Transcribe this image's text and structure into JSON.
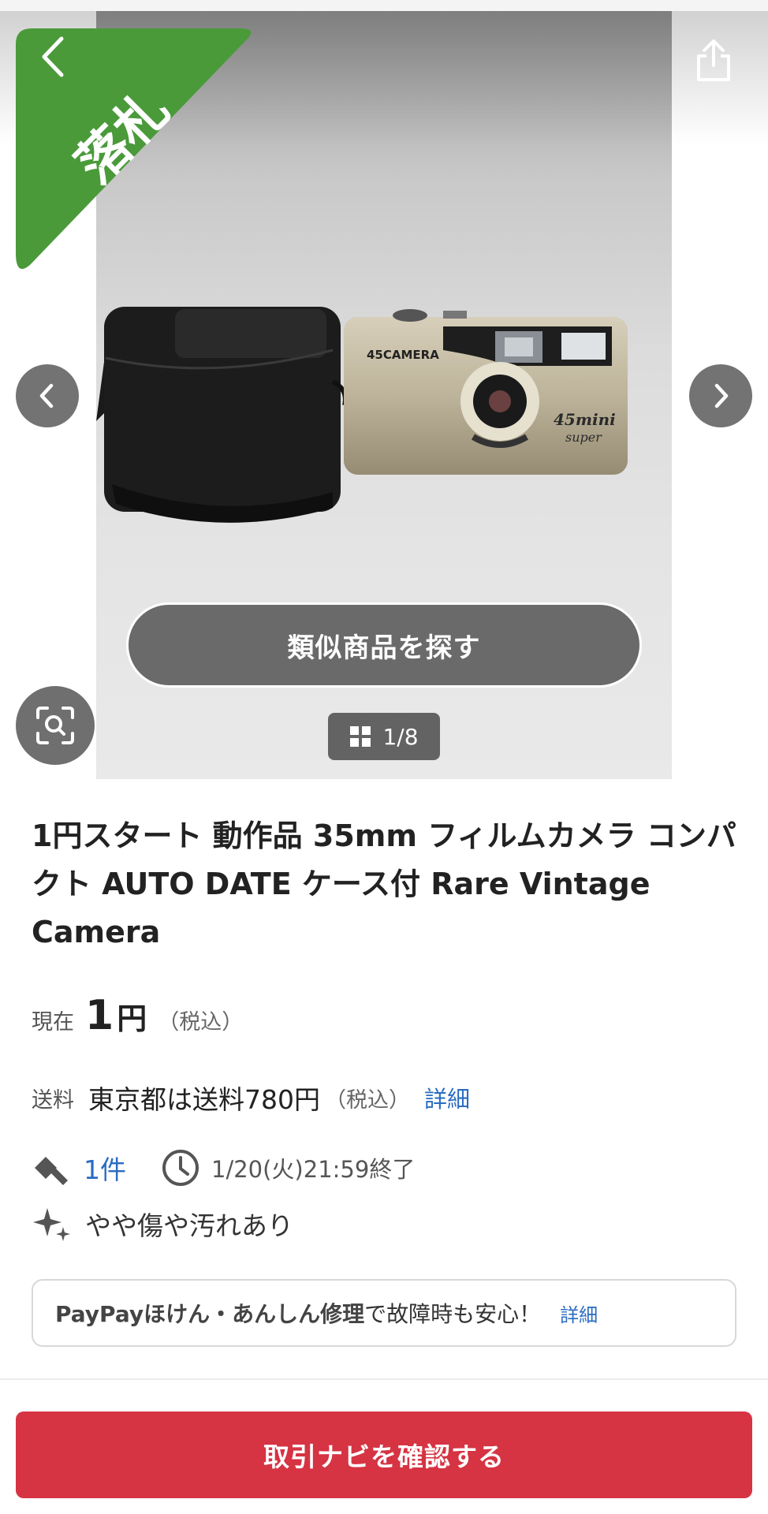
{
  "header": {
    "badge_text": "落札",
    "badge_color": "#4a9a3a",
    "back_icon": "chevron-left-icon",
    "share_icon": "share-icon"
  },
  "gallery": {
    "similar_button_label": "類似商品を探す",
    "counter": "1/8",
    "prev_icon": "chevron-left-icon",
    "next_icon": "chevron-right-icon",
    "lens_icon": "image-search-icon",
    "camera_brand": "45CAMERA",
    "camera_model": "45mini",
    "camera_sub": "super"
  },
  "item": {
    "title": "1円スタート 動作品 35mm フィルムカメラ コンパクト AUTO DATE ケース付 Rare Vintage Camera",
    "price_label": "現在",
    "price_value": "1",
    "price_unit": "円",
    "price_tax": "（税込）",
    "shipping_label": "送料",
    "shipping_text": "東京都は送料780円",
    "shipping_tax": "（税込）",
    "shipping_detail_link": "詳細",
    "bid_count": "1件",
    "end_time": "1/20(火)21:59終了",
    "condition": "やや傷や汚れあり"
  },
  "insurance": {
    "strong_text": "PayPayほけん・あんしん修理",
    "normal_text": "で故障時も安心！",
    "link_text": "詳細"
  },
  "footer": {
    "cta_label": "取引ナビを確認する",
    "cta_color": "#d63343"
  },
  "colors": {
    "link": "#2a6cc2",
    "text": "#222222"
  }
}
